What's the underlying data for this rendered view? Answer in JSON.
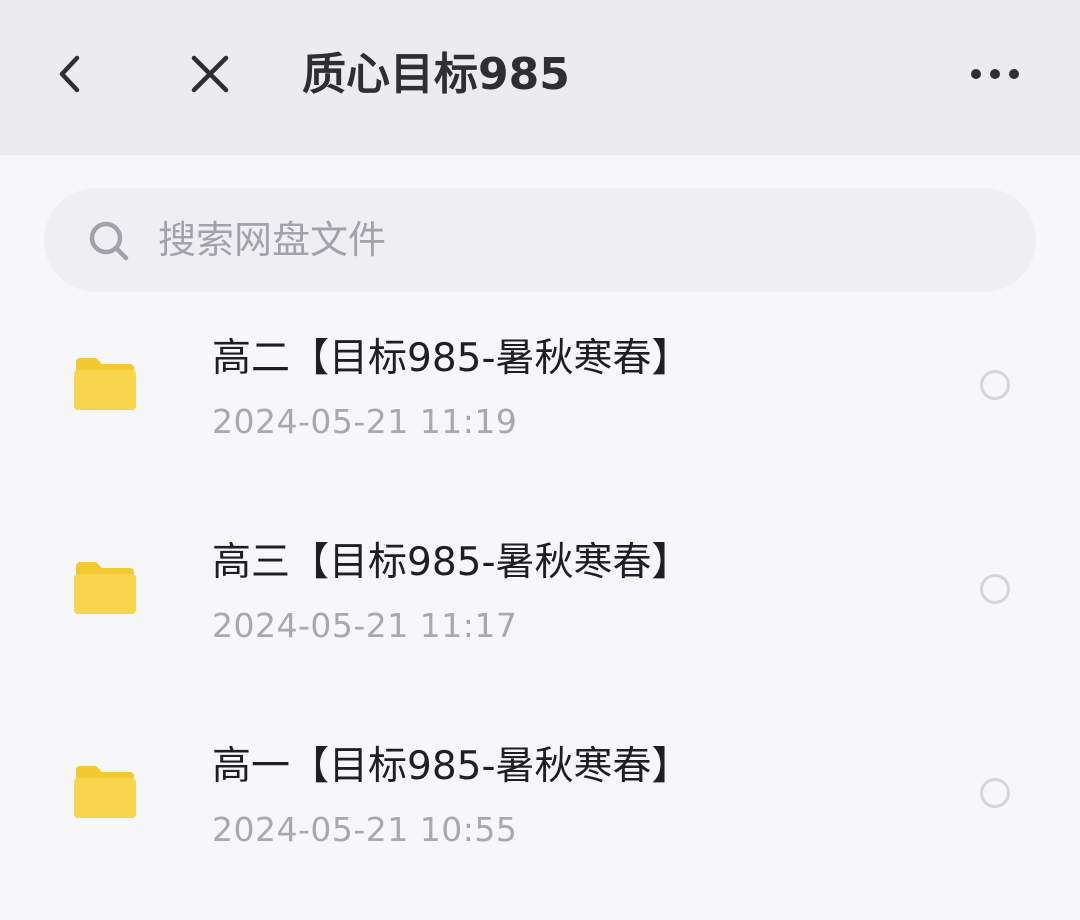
{
  "header": {
    "title": "质心目标985",
    "back_icon": "chevron-left-icon",
    "close_icon": "close-icon",
    "more_icon": "more-horizontal-icon"
  },
  "search": {
    "placeholder": "搜索网盘文件",
    "value": "",
    "icon": "search-icon"
  },
  "files": [
    {
      "name": "高二【目标985-暑秋寒春】",
      "date": "2024-05-21  11:19",
      "type": "folder",
      "selected": false
    },
    {
      "name": "高三【目标985-暑秋寒春】",
      "date": "2024-05-21  11:17",
      "type": "folder",
      "selected": false
    },
    {
      "name": "高一【目标985-暑秋寒春】",
      "date": "2024-05-21  10:55",
      "type": "folder",
      "selected": false
    }
  ],
  "colors": {
    "header_bg": "#ececf0",
    "page_bg": "#f7f7f9",
    "folder_front": "#f7d54c",
    "folder_back": "#f2c930",
    "radio_border": "#d6d6da"
  }
}
